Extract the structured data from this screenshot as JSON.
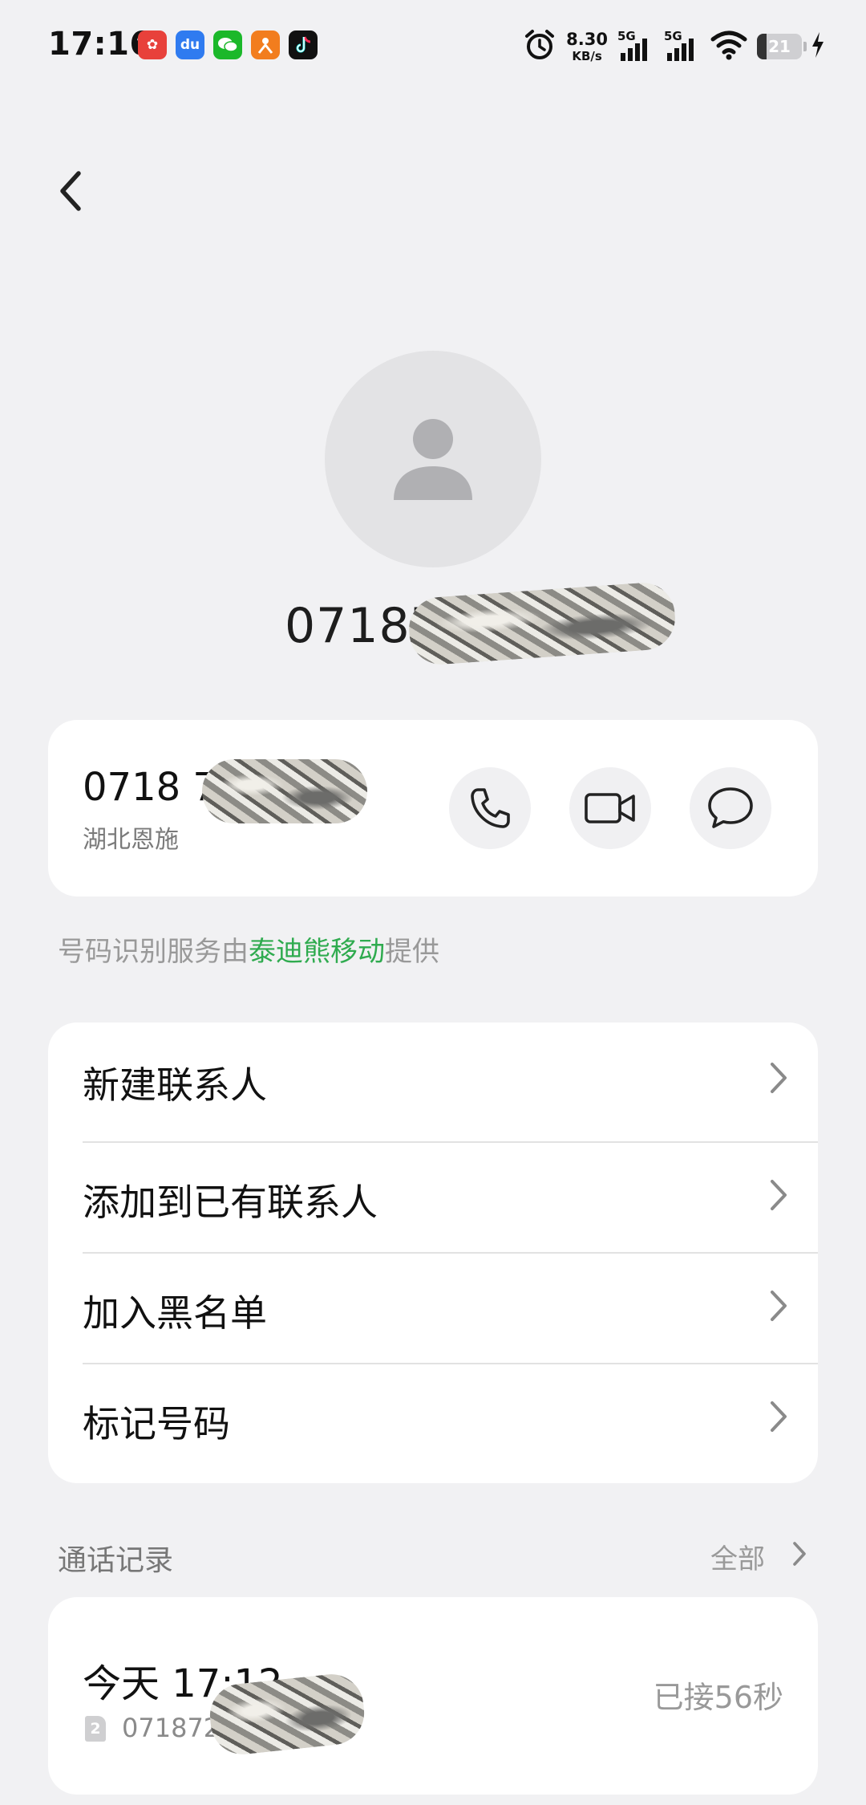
{
  "status_bar": {
    "time": "17:16",
    "net_speed_value": "8.30",
    "net_speed_unit": "KB/s",
    "sim1_label": "5G",
    "sim2_label": "5G",
    "battery_level": "21",
    "app_icons": [
      "app-icon-1",
      "baidu-icon",
      "wechat-icon",
      "app-icon-4",
      "tiktok-icon"
    ],
    "app_icon_colors": [
      "#e8413b",
      "#2f7bf0",
      "#1bb82a",
      "#f27d1e",
      "#111111"
    ]
  },
  "header": {
    "back_icon": "chevron-left-icon",
    "avatar_icon": "person-icon",
    "title_number_visible": "07187"
  },
  "number_card": {
    "number_visible": "0718 7",
    "location": "湖北恩施",
    "actions": [
      {
        "name": "call-button",
        "icon": "phone-icon"
      },
      {
        "name": "video-call-button",
        "icon": "video-icon"
      },
      {
        "name": "message-button",
        "icon": "chat-bubble-icon"
      }
    ]
  },
  "service_note": {
    "prefix": "号码识别服务由",
    "provider": "泰迪熊移动",
    "suffix": "提供",
    "provider_color": "#2fab4f"
  },
  "menu": {
    "items": [
      {
        "label": "新建联系人"
      },
      {
        "label": "添加到已有联系人"
      },
      {
        "label": "加入黑名单"
      },
      {
        "label": "标记号码"
      }
    ]
  },
  "call_log": {
    "title": "通话记录",
    "all_label": "全部",
    "entries": [
      {
        "time": "今天 17:12",
        "sim": "2",
        "number_visible": "071872",
        "status": "已接56秒"
      }
    ]
  }
}
